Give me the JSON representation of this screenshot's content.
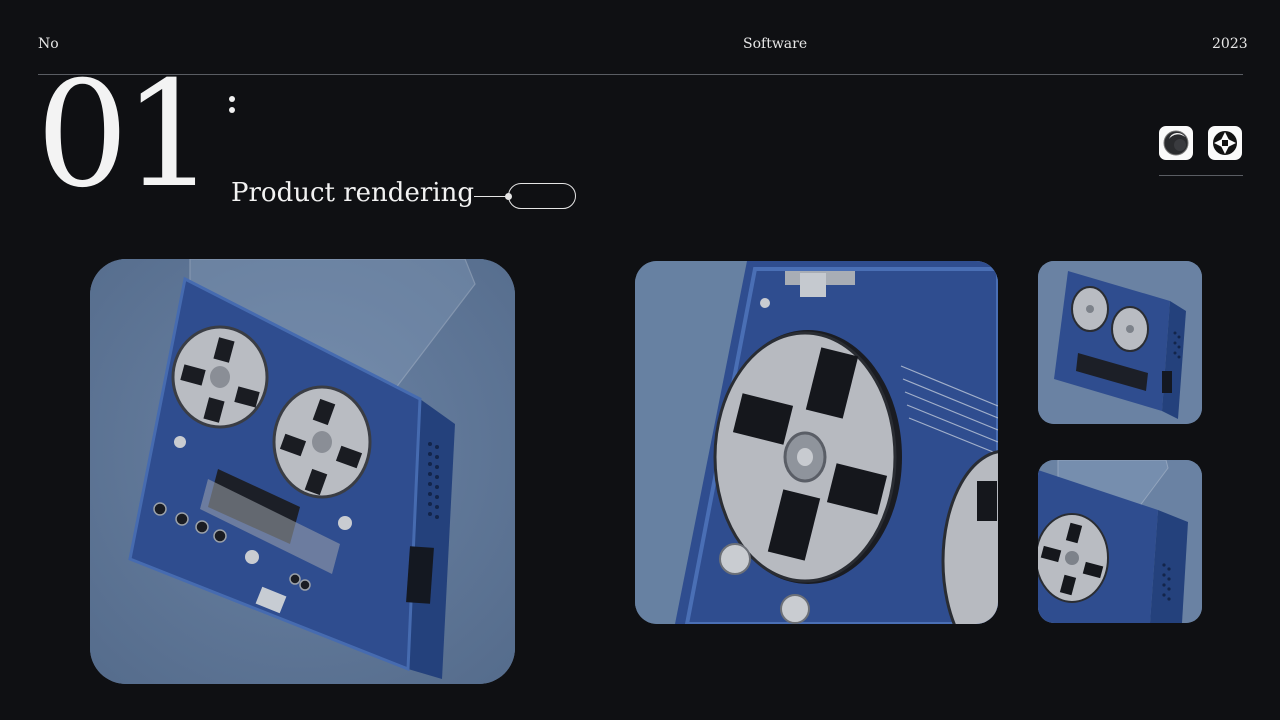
{
  "header": {
    "left": "No",
    "center": "Software",
    "right": "2023"
  },
  "hero": {
    "number": "01",
    "title": "Product rendering"
  },
  "software_icons": [
    "cinema4d-icon",
    "octane-icon"
  ],
  "images": {
    "main": "reel-to-reel-tape-recorder-render",
    "zoom": "reel-closeup-render",
    "thumb_1": "recorder-side-view-render",
    "thumb_2": "recorder-lid-open-render"
  },
  "colors": {
    "background": "#0f1013",
    "card_background": "#5e7696",
    "device_blue": "#2f4d8f",
    "reel_silver": "#b9bcc2"
  }
}
